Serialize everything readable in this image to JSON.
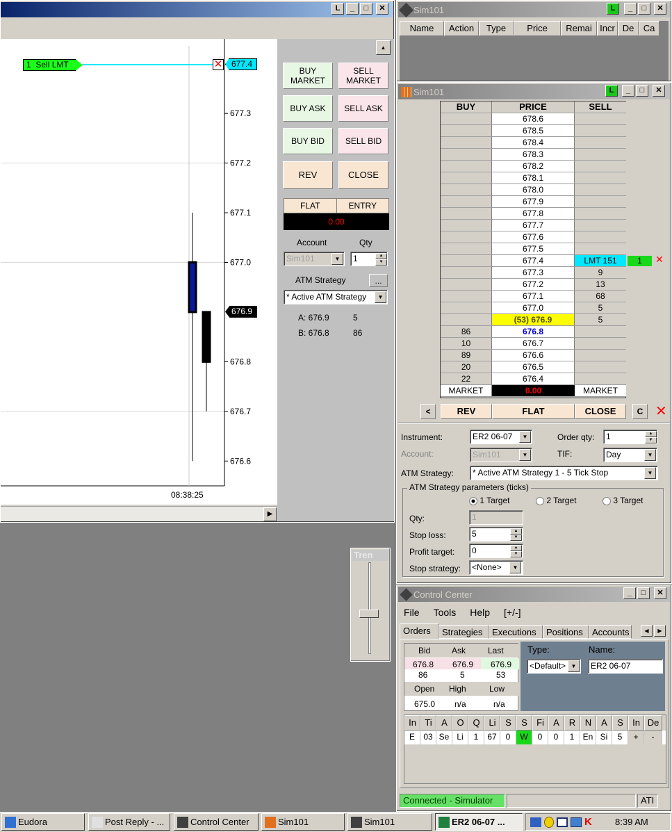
{
  "chart_window": {
    "title": "",
    "order_marker": {
      "qty": "1",
      "label": "Sell LMT",
      "price_label": "677.4"
    },
    "y_ticks": [
      "677.3",
      "677.2",
      "677.1",
      "677.0",
      "676.8",
      "676.7",
      "676.6"
    ],
    "last_price_label": "676.9",
    "time_label": "08:38:25",
    "chart_data": {
      "type": "candlestick",
      "title": "",
      "xlabel": "",
      "ylabel": "",
      "ylim": [
        676.55,
        677.45
      ],
      "x": [
        "08:38:25"
      ],
      "series": [
        {
          "values": [
            {
              "open": 676.9,
              "high": 677.1,
              "low": 676.6,
              "close": 677.0
            },
            {
              "open": 676.9,
              "high": 676.9,
              "low": 676.7,
              "close": 676.8
            }
          ]
        }
      ]
    }
  },
  "order_panel": {
    "buy_market": "BUY MARKET",
    "sell_market": "SELL MARKET",
    "buy_ask": "BUY ASK",
    "sell_ask": "SELL ASK",
    "buy_bid": "BUY BID",
    "sell_bid": "SELL BID",
    "rev": "REV",
    "close": "CLOSE",
    "flat": "FLAT",
    "entry": "ENTRY",
    "pnl": "0.00",
    "account_label": "Account",
    "qty_label": "Qty",
    "account_value": "Sim101",
    "qty_value": "1",
    "atm_label": "ATM Strategy",
    "atm_btn": "...",
    "atm_value": "* Active ATM Strategy",
    "ask_line": "A: 676.9",
    "ask_size": "5",
    "bid_line": "B: 676.8",
    "bid_size": "86"
  },
  "trend_widget": {
    "title": "Tren"
  },
  "orders_window": {
    "title": "Sim101",
    "columns": [
      "Name",
      "Action",
      "Type",
      "Price",
      "Remai",
      "Incr",
      "De",
      "Ca"
    ]
  },
  "dom_window": {
    "title": "Sim101",
    "headers": {
      "buy": "BUY",
      "price": "PRICE",
      "sell": "SELL"
    },
    "rows": [
      {
        "buy": "",
        "price": "678.6",
        "sell": ""
      },
      {
        "buy": "",
        "price": "678.5",
        "sell": ""
      },
      {
        "buy": "",
        "price": "678.4",
        "sell": ""
      },
      {
        "buy": "",
        "price": "678.3",
        "sell": ""
      },
      {
        "buy": "",
        "price": "678.2",
        "sell": ""
      },
      {
        "buy": "",
        "price": "678.1",
        "sell": ""
      },
      {
        "buy": "",
        "price": "678.0",
        "sell": ""
      },
      {
        "buy": "",
        "price": "677.9",
        "sell": ""
      },
      {
        "buy": "",
        "price": "677.8",
        "sell": ""
      },
      {
        "buy": "",
        "price": "677.7",
        "sell": ""
      },
      {
        "buy": "",
        "price": "677.6",
        "sell": ""
      },
      {
        "buy": "",
        "price": "677.5",
        "sell": ""
      },
      {
        "buy": "",
        "price": "677.4",
        "sell": "LMT 151"
      },
      {
        "buy": "",
        "price": "677.3",
        "sell": "9"
      },
      {
        "buy": "",
        "price": "677.2",
        "sell": "13"
      },
      {
        "buy": "",
        "price": "677.1",
        "sell": "68"
      },
      {
        "buy": "",
        "price": "677.0",
        "sell": "5"
      },
      {
        "buy": "",
        "price": "(53) 676.9",
        "sell": "5"
      },
      {
        "buy": "86",
        "price": "676.8",
        "sell": ""
      },
      {
        "buy": "10",
        "price": "676.7",
        "sell": ""
      },
      {
        "buy": "89",
        "price": "676.6",
        "sell": ""
      },
      {
        "buy": "20",
        "price": "676.5",
        "sell": ""
      },
      {
        "buy": "22",
        "price": "676.4",
        "sell": ""
      }
    ],
    "order_qty_tag": "1",
    "market_row": {
      "buy": "MARKET",
      "pnl": "0.00",
      "sell": "MARKET"
    },
    "bottom_buttons": {
      "left": "<",
      "rev": "REV",
      "flat": "FLAT",
      "close": "CLOSE",
      "c": "C"
    },
    "instrument_label": "Instrument:",
    "instrument_value": "ER2 06-07",
    "account_label": "Account:",
    "account_value": "Sim101",
    "order_qty_label": "Order qty:",
    "order_qty_value": "1",
    "tif_label": "TIF:",
    "tif_value": "Day",
    "atm_label": "ATM Strategy:",
    "atm_value": "* Active ATM Strategy 1 - 5 Tick Stop",
    "params_title": "ATM Strategy parameters (ticks)",
    "target1": "1 Target",
    "target2": "2 Target",
    "target3": "3 Target",
    "qty_label": "Qty:",
    "qty_value": "1",
    "stop_loss_label": "Stop loss:",
    "stop_loss_value": "5",
    "profit_target_label": "Profit target:",
    "profit_target_value": "0",
    "stop_strategy_label": "Stop strategy:",
    "stop_strategy_value": "<None>"
  },
  "control_center": {
    "title": "Control Center",
    "menu": [
      "File",
      "Tools",
      "Help",
      "[+/-]"
    ],
    "tabs": [
      "Orders",
      "Strategies",
      "Executions",
      "Positions",
      "Accounts"
    ],
    "quote": {
      "bid_label": "Bid",
      "ask_label": "Ask",
      "last_label": "Last",
      "bid": "676.8",
      "ask": "676.9",
      "last": "676.9",
      "bid_size": "86",
      "ask_size": "5",
      "last_size": "53",
      "open_label": "Open",
      "high_label": "High",
      "low_label": "Low",
      "open": "675.0",
      "high": "n/a",
      "low": "n/a"
    },
    "type_label": "Type:",
    "name_label": "Name:",
    "type_value": "<Default>",
    "name_value": "ER2 06-07",
    "grid_headers": [
      "In",
      "Ti",
      "A",
      "O",
      "Q",
      "Li",
      "S",
      "S",
      "Fi",
      "A",
      "R",
      "N",
      "A",
      "S",
      "In",
      "De"
    ],
    "grid_row": [
      "E",
      "03",
      "Se",
      "Li",
      "1",
      "67",
      "0",
      "W",
      "0",
      "0",
      "1",
      "En",
      "Si",
      "5",
      "+",
      "-"
    ],
    "status": "Connected - Simulator",
    "status_right": "ATI"
  },
  "taskbar": {
    "items": [
      "Eudora",
      "Post Reply - ...",
      "Control Center",
      "Sim101",
      "Sim101",
      "ER2 06-07 ..."
    ],
    "clock": "8:39 AM"
  }
}
